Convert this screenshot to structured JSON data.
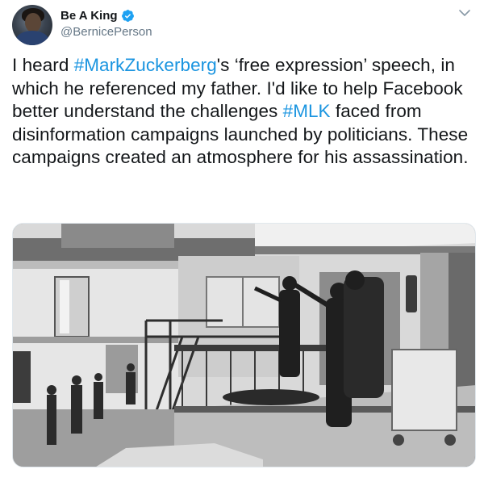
{
  "author": {
    "display_name": "Be A King",
    "handle": "@BernicePerson",
    "verified": true,
    "avatar_icon": "user-avatar"
  },
  "menu_icon": "chevron-down-icon",
  "tweet_text": {
    "part1": "I heard ",
    "hashtag1": "#MarkZuckerberg",
    "part2": "'s ‘free expression’ speech, in which he referenced my father. I'd like to help Facebook better understand the challenges ",
    "hashtag2": "#MLK",
    "part3": " faced from disinformation campaigns launched by politicians. These campaigns created an atmosphere for his assassination."
  },
  "colors": {
    "hashtag": "#1b95e0",
    "text": "#14171a",
    "secondary": "#657786",
    "verified_badge": "#1da1f2",
    "border": "#e1e8ed"
  },
  "media": {
    "type": "black-and-white photo",
    "icon": "photo-icon"
  }
}
